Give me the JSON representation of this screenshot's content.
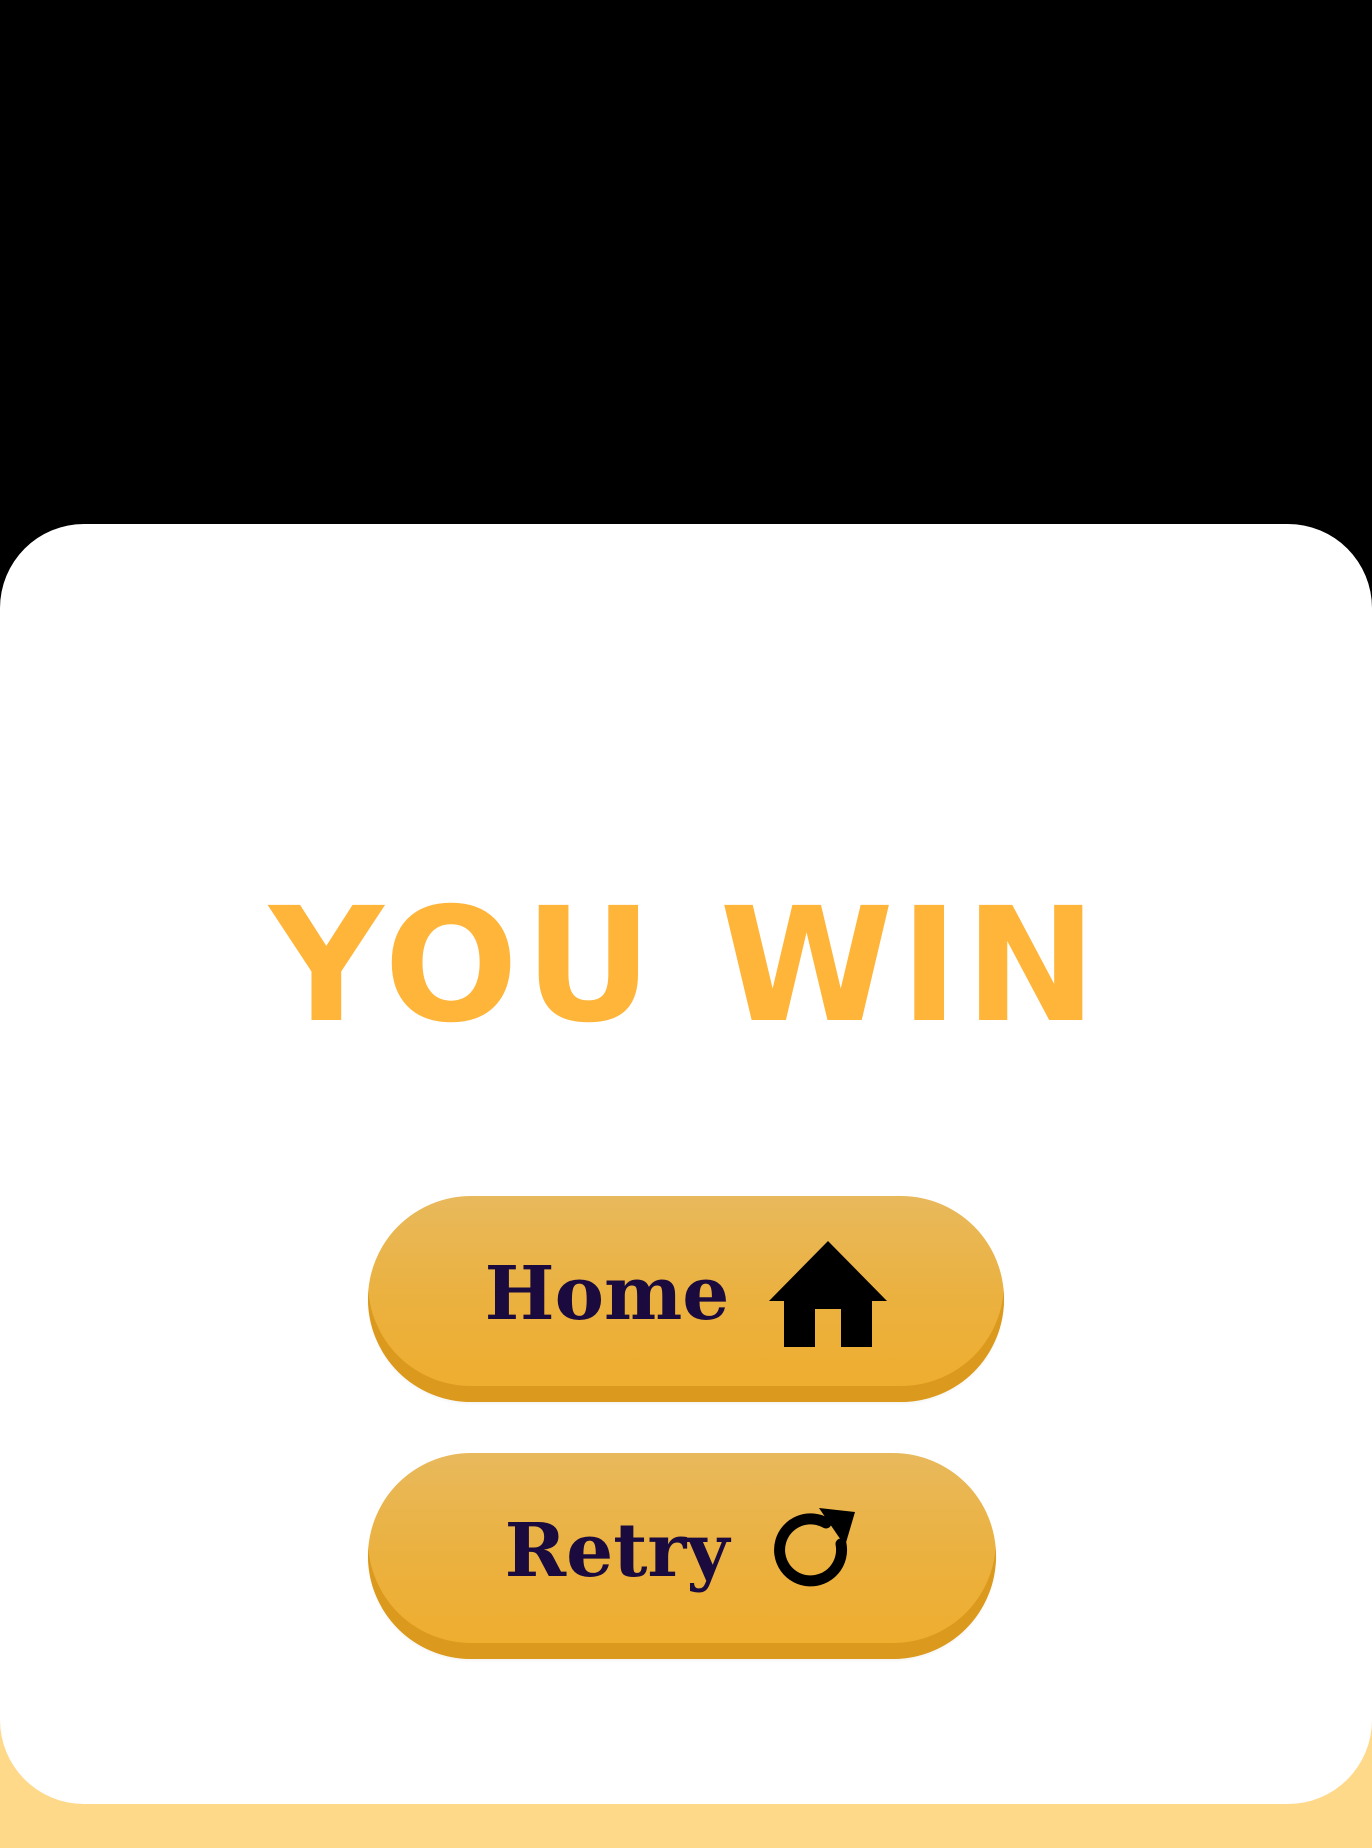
{
  "screen": {
    "background_color": "#000000",
    "panel_color": "#ffffff",
    "panel_shadow_color": "#ffd98a"
  },
  "result": {
    "title": "YOU WIN",
    "title_color": "#ffb43a"
  },
  "buttons": {
    "home": {
      "label": "Home",
      "icon": "home-icon"
    },
    "retry": {
      "label": "Retry",
      "icon": "refresh-icon"
    },
    "button_color": "#ebb13f",
    "label_color": "#1a0a3d"
  }
}
